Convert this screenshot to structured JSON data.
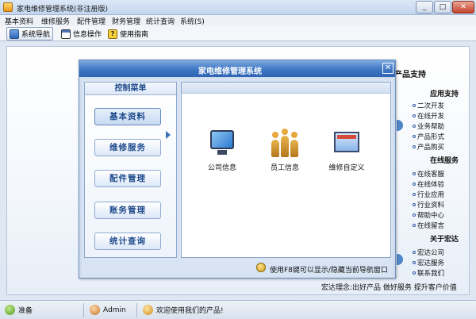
{
  "window": {
    "title": "家电维修管理系统(非注册版)"
  },
  "menu": [
    "基本资料",
    "维修服务",
    "配件管理",
    "财务管理",
    "统计查询",
    "系统(S)"
  ],
  "toolbar": {
    "nav": "系统导航",
    "ops": "信息操作",
    "help": "使用指南"
  },
  "right_panel": {
    "header": "产品支持",
    "sections": [
      {
        "title": "应用支持",
        "items": [
          "二次开发",
          "在线开发",
          "业务帮助",
          "产品形式",
          "产品购买"
        ]
      },
      {
        "title": "在线服务",
        "items": [
          "在线客服",
          "在线体验",
          "行业应用",
          "行业资料",
          "帮助中心",
          "在线留言"
        ]
      },
      {
        "title": "关于宏达",
        "items": [
          "宏达公司",
          "宏达服务",
          "联系我们"
        ]
      }
    ]
  },
  "mission": "宏达理念:出好产品  做好服务  提升客户价值",
  "dialog": {
    "title": "家电维修管理系统",
    "close": "✕",
    "control_menu_title": "控制菜单",
    "control_buttons": [
      "基本资料",
      "维修服务",
      "配件管理",
      "账务管理",
      "统计查询"
    ],
    "selected_index": 0,
    "functions": [
      {
        "label": "公司信息",
        "icon": "monitor-icon"
      },
      {
        "label": "员工信息",
        "icon": "people-icon"
      },
      {
        "label": "维修自定义",
        "icon": "custom-icon"
      }
    ],
    "footer_hint": "使用F8键可以显示/隐藏当前导航窗口"
  },
  "status": {
    "ready": "准备",
    "user": "Admin",
    "welcome": "欢迎使用我们的产品!"
  }
}
